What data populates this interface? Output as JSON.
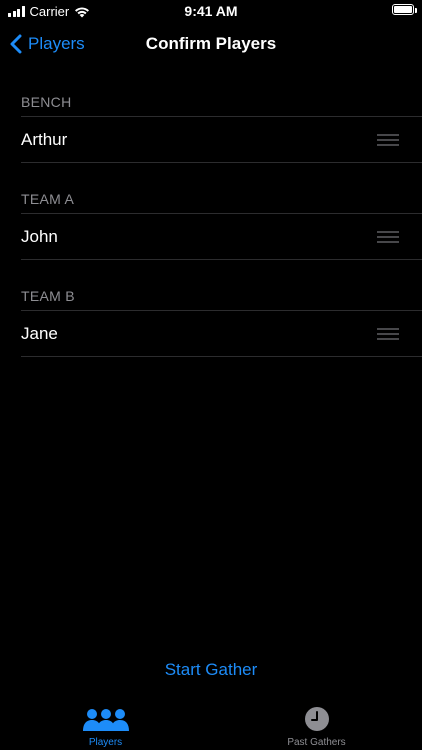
{
  "status_bar": {
    "carrier": "Carrier",
    "time": "9:41 AM",
    "battery_level": 1.0
  },
  "nav": {
    "back_label": "Players",
    "title": "Confirm Players"
  },
  "sections": [
    {
      "header": "BENCH",
      "players": [
        "Arthur"
      ]
    },
    {
      "header": "TEAM A",
      "players": [
        "John"
      ]
    },
    {
      "header": "TEAM B",
      "players": [
        "Jane"
      ]
    }
  ],
  "actions": {
    "start_label": "Start Gather"
  },
  "tabs": [
    {
      "label": "Players",
      "icon": "people-icon",
      "selected": true
    },
    {
      "label": "Past Gathers",
      "icon": "clock-icon",
      "selected": false
    }
  ],
  "colors": {
    "accent": "#1d8cf8",
    "inactive": "#8e8e93",
    "background": "#000000"
  }
}
